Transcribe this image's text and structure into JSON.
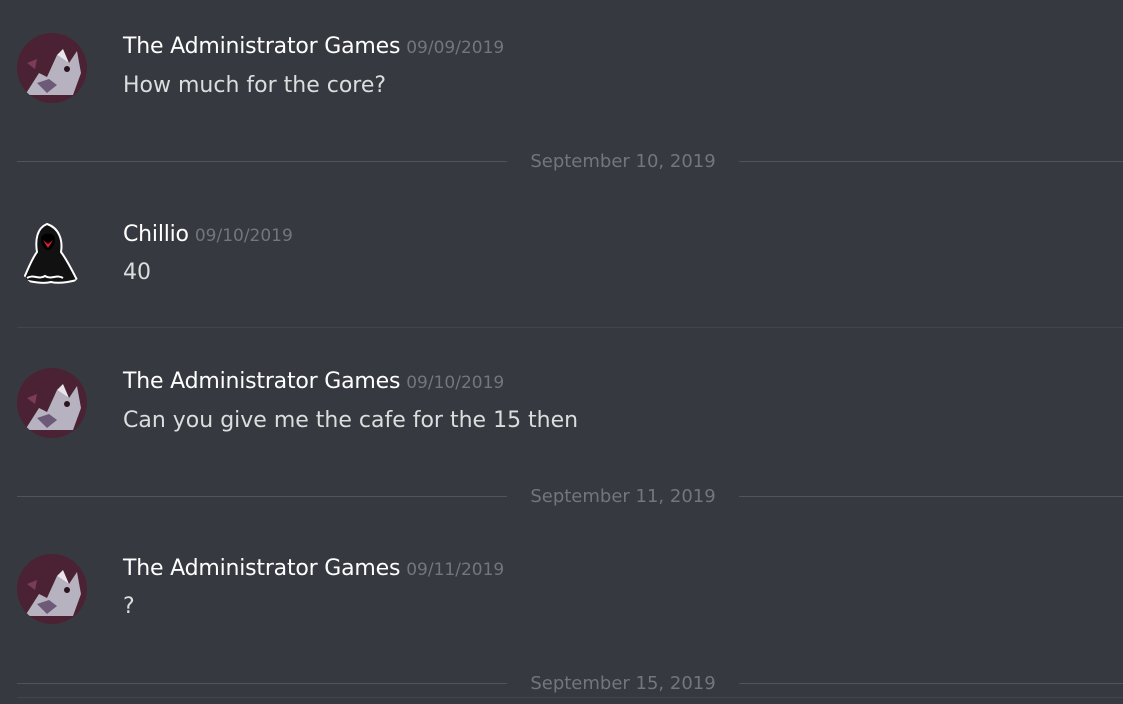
{
  "messages": [
    {
      "author": "The Administrator Games",
      "timestamp": "09/09/2019",
      "content": "How much for the core?",
      "avatar_icon": "purple-wolf-avatar"
    },
    {
      "author": "Chillio",
      "timestamp": "09/10/2019",
      "content": "40",
      "avatar_icon": "hooded-figure-avatar"
    },
    {
      "author": "The Administrator Games",
      "timestamp": "09/10/2019",
      "content": "Can you give me the cafe for the 15 then",
      "avatar_icon": "purple-wolf-avatar"
    },
    {
      "author": "The Administrator Games",
      "timestamp": "09/11/2019",
      "content": "?",
      "avatar_icon": "purple-wolf-avatar"
    }
  ],
  "date_dividers": [
    "September 10, 2019",
    "September 11, 2019",
    "September 15, 2019"
  ],
  "colors": {
    "background": "#36393f",
    "author": "#ffffff",
    "text": "#dcddde",
    "muted": "#72767d",
    "divider": "#4f545c"
  }
}
